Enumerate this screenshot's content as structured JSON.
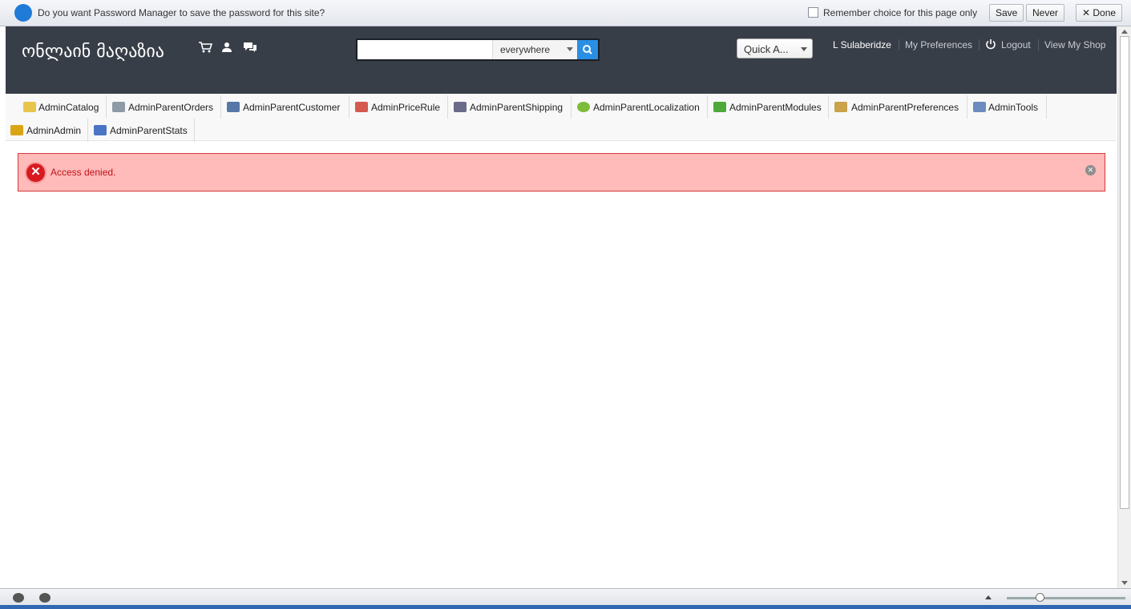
{
  "password_bar": {
    "message": "Do you want Password Manager to save the password for this site?",
    "remember_label": "Remember choice for this page only",
    "save_label": "Save",
    "never_label": "Never",
    "done_label": "✕ Done"
  },
  "header": {
    "logo": "ონლაინ მაღაზია",
    "search": {
      "value": "",
      "scope": "everywhere"
    },
    "quick_access": "Quick A...",
    "user_name": "L Sulaberidze",
    "preferences": "My Preferences",
    "logout": "Logout",
    "view_shop": "View My Shop"
  },
  "menu": {
    "items": [
      {
        "label": "AdminCatalog",
        "icon": "folder-icon",
        "color": "#e8c44a"
      },
      {
        "label": "AdminParentOrders",
        "icon": "cart-icon",
        "color": "#8f9aa7"
      },
      {
        "label": "AdminParentCustomer",
        "icon": "person-icon",
        "color": "#5677a8"
      },
      {
        "label": "AdminPriceRule",
        "icon": "price-rule-icon",
        "color": "#d45a4f"
      },
      {
        "label": "AdminParentShipping",
        "icon": "truck-icon",
        "color": "#6a6a8a"
      },
      {
        "label": "AdminParentLocalization",
        "icon": "globe-icon",
        "color": "#7dbb3a"
      },
      {
        "label": "AdminParentModules",
        "icon": "puzzle-icon",
        "color": "#4caa3a"
      },
      {
        "label": "AdminParentPreferences",
        "icon": "preferences-icon",
        "color": "#c9a24a"
      },
      {
        "label": "AdminTools",
        "icon": "wrench-icon",
        "color": "#6c8bbf"
      },
      {
        "label": "AdminAdmin",
        "icon": "key-icon",
        "color": "#d9a514"
      },
      {
        "label": "AdminParentStats",
        "icon": "bar-chart-icon",
        "color": "#4a75c4"
      }
    ]
  },
  "alert": {
    "message": "Access denied.",
    "color": "#ffbaba"
  }
}
